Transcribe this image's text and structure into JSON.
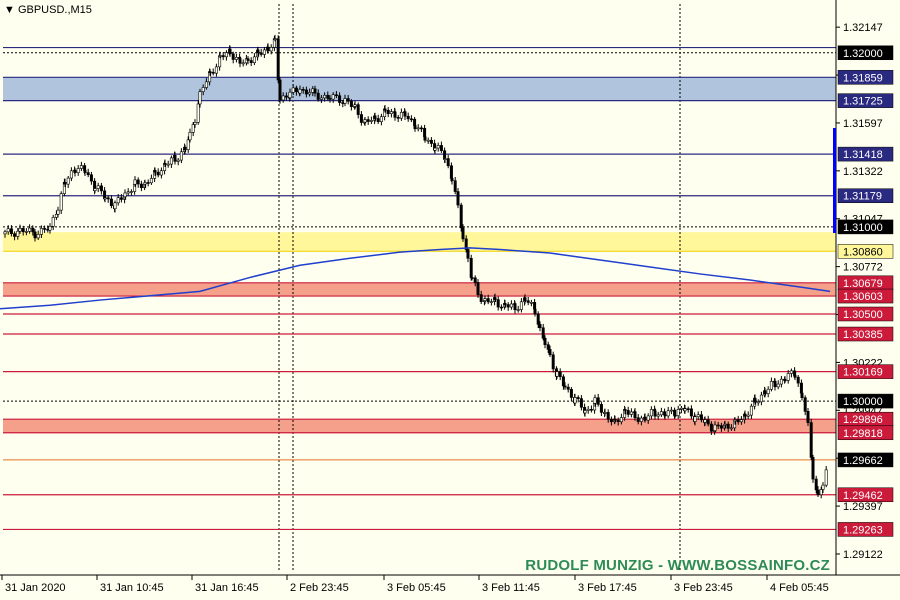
{
  "symbol_label": "GBPUSD.,M15",
  "watermark": "RUDOLF MUNZIG - WWW.BOSSAINFO.CZ",
  "colors": {
    "background": "#fffff0",
    "candle": "#000000",
    "ma_line": "#1f3fcc",
    "resistance_line": "#2a2a80",
    "support_line": "#cc1a3a",
    "blue_zone": "#b0c4de",
    "yellow_zone": "#fff79a",
    "red_zone": "#f4a08a",
    "scroll_marker": "#0000ff"
  },
  "chart_data": {
    "type": "candlestick",
    "title": "GBPUSD.,M15",
    "ylim": [
      1.2903,
      1.3228
    ],
    "y_ticks": [
      "1.32147",
      "1.31872",
      "1.31597",
      "1.31322",
      "1.31047",
      "1.30772",
      "1.30497",
      "1.30222",
      "1.29947",
      "1.29672",
      "1.29397",
      "1.29122"
    ],
    "x_ticks": [
      "31 Jan 2020",
      "31 Jan 10:45",
      "31 Jan 16:45",
      "2 Feb 23:45",
      "3 Feb 05:45",
      "3 Feb 11:45",
      "3 Feb 17:45",
      "3 Feb 23:45",
      "4 Feb 05:45"
    ],
    "price_levels": [
      {
        "label": "1.32000",
        "value": 1.32,
        "kind": "round",
        "style": "dotted-black"
      },
      {
        "label": "1.32000",
        "value": 1.3203,
        "kind": "resistance",
        "style": "solid-navy"
      },
      {
        "label": "1.31859",
        "value": 1.31859,
        "kind": "resistance",
        "style": "solid-navy"
      },
      {
        "label": "1.31725",
        "value": 1.31725,
        "kind": "resistance",
        "style": "solid-navy"
      },
      {
        "label": "1.31418",
        "value": 1.31418,
        "kind": "resistance",
        "style": "solid-navy"
      },
      {
        "label": "1.31179",
        "value": 1.31179,
        "kind": "resistance",
        "style": "solid-navy"
      },
      {
        "label": "1.31000",
        "value": 1.31,
        "kind": "round",
        "style": "dotted-black"
      },
      {
        "label": "1.30860",
        "value": 1.3086,
        "kind": "zone-edge",
        "style": "solid-yellow"
      },
      {
        "label": "1.30679",
        "value": 1.30679,
        "kind": "support",
        "style": "solid-red"
      },
      {
        "label": "1.30603",
        "value": 1.30603,
        "kind": "support",
        "style": "solid-red"
      },
      {
        "label": "1.30500",
        "value": 1.305,
        "kind": "support",
        "style": "solid-red"
      },
      {
        "label": "1.30385",
        "value": 1.30385,
        "kind": "support",
        "style": "solid-red"
      },
      {
        "label": "1.30169",
        "value": 1.30169,
        "kind": "support",
        "style": "solid-red"
      },
      {
        "label": "1.30000",
        "value": 1.3,
        "kind": "round",
        "style": "dotted-black"
      },
      {
        "label": "1.29896",
        "value": 1.29896,
        "kind": "support",
        "style": "solid-red"
      },
      {
        "label": "1.29818",
        "value": 1.29818,
        "kind": "support",
        "style": "solid-red"
      },
      {
        "label": "1.29662",
        "value": 1.29662,
        "kind": "current",
        "style": "solid-orange"
      },
      {
        "label": "1.29462",
        "value": 1.29462,
        "kind": "support",
        "style": "solid-red"
      },
      {
        "label": "1.29263",
        "value": 1.29263,
        "kind": "support",
        "style": "solid-red"
      }
    ],
    "zones": [
      {
        "from": 1.31725,
        "to": 1.31859,
        "color": "blue_zone"
      },
      {
        "from": 1.3086,
        "to": 1.3097,
        "color": "yellow_zone"
      },
      {
        "from": 1.30603,
        "to": 1.30679,
        "color": "red_zone"
      },
      {
        "from": 1.29818,
        "to": 1.29896,
        "color": "red_zone"
      }
    ],
    "moving_average": {
      "name": "MA",
      "points": [
        [
          0,
          1.3053
        ],
        [
          50,
          1.3055
        ],
        [
          100,
          1.3058
        ],
        [
          150,
          1.30605
        ],
        [
          200,
          1.3063
        ],
        [
          250,
          1.3071
        ],
        [
          300,
          1.3078
        ],
        [
          350,
          1.3082
        ],
        [
          400,
          1.30855
        ],
        [
          440,
          1.3087
        ],
        [
          470,
          1.3088
        ],
        [
          500,
          1.3087
        ],
        [
          550,
          1.3085
        ],
        [
          600,
          1.3081
        ],
        [
          650,
          1.3077
        ],
        [
          700,
          1.3073
        ],
        [
          750,
          1.30695
        ],
        [
          800,
          1.30655
        ],
        [
          830,
          1.3063
        ]
      ]
    },
    "candles_close_path": [
      [
        5,
        1.3096
      ],
      [
        20,
        1.3098
      ],
      [
        35,
        1.30965
      ],
      [
        50,
        1.3099
      ],
      [
        58,
        1.3112
      ],
      [
        65,
        1.3125
      ],
      [
        75,
        1.3134
      ],
      [
        85,
        1.3132
      ],
      [
        95,
        1.3123
      ],
      [
        105,
        1.3117
      ],
      [
        115,
        1.3112
      ],
      [
        125,
        1.3119
      ],
      [
        135,
        1.3124
      ],
      [
        145,
        1.3125
      ],
      [
        155,
        1.313
      ],
      [
        165,
        1.3136
      ],
      [
        175,
        1.3139
      ],
      [
        185,
        1.3145
      ],
      [
        190,
        1.3152
      ],
      [
        195,
        1.3163
      ],
      [
        200,
        1.3176
      ],
      [
        210,
        1.3188
      ],
      [
        220,
        1.3197
      ],
      [
        230,
        1.3201
      ],
      [
        240,
        1.3194
      ],
      [
        248,
        1.3196
      ],
      [
        258,
        1.3199
      ],
      [
        268,
        1.3203
      ],
      [
        275,
        1.3206
      ],
      [
        280,
        1.3174
      ],
      [
        290,
        1.3176
      ],
      [
        300,
        1.3179
      ],
      [
        315,
        1.3176
      ],
      [
        330,
        1.3174
      ],
      [
        345,
        1.3173
      ],
      [
        355,
        1.3168
      ],
      [
        365,
        1.316
      ],
      [
        375,
        1.3162
      ],
      [
        385,
        1.3166
      ],
      [
        395,
        1.3165
      ],
      [
        405,
        1.3164
      ],
      [
        415,
        1.3159
      ],
      [
        425,
        1.3151
      ],
      [
        435,
        1.3146
      ],
      [
        445,
        1.314
      ],
      [
        452,
        1.3128
      ],
      [
        458,
        1.311
      ],
      [
        463,
        1.3095
      ],
      [
        468,
        1.3082
      ],
      [
        472,
        1.307
      ],
      [
        478,
        1.3061
      ],
      [
        485,
        1.3058
      ],
      [
        495,
        1.3057
      ],
      [
        505,
        1.3055
      ],
      [
        515,
        1.3054
      ],
      [
        525,
        1.3058
      ],
      [
        535,
        1.3053
      ],
      [
        540,
        1.304
      ],
      [
        545,
        1.3033
      ],
      [
        550,
        1.3026
      ],
      [
        557,
        1.3015
      ],
      [
        565,
        1.3008
      ],
      [
        575,
        1.3001
      ],
      [
        585,
        1.2994
      ],
      [
        595,
        1.2999
      ],
      [
        605,
        1.2993
      ],
      [
        615,
        1.2987
      ],
      [
        625,
        1.2995
      ],
      [
        635,
        1.2991
      ],
      [
        645,
        1.299
      ],
      [
        655,
        1.2994
      ],
      [
        665,
        1.2992
      ],
      [
        675,
        1.2994
      ],
      [
        685,
        1.2995
      ],
      [
        695,
        1.2991
      ],
      [
        705,
        1.2988
      ],
      [
        715,
        1.2984
      ],
      [
        725,
        1.2986
      ],
      [
        735,
        1.2987
      ],
      [
        745,
        1.2992
      ],
      [
        755,
        1.2999
      ],
      [
        765,
        1.3006
      ],
      [
        775,
        1.301
      ],
      [
        785,
        1.3013
      ],
      [
        795,
        1.3016
      ],
      [
        802,
        1.3003
      ],
      [
        808,
        1.2985
      ],
      [
        813,
        1.2958
      ],
      [
        818,
        1.2945
      ],
      [
        823,
        1.2952
      ],
      [
        828,
        1.2962
      ]
    ]
  }
}
